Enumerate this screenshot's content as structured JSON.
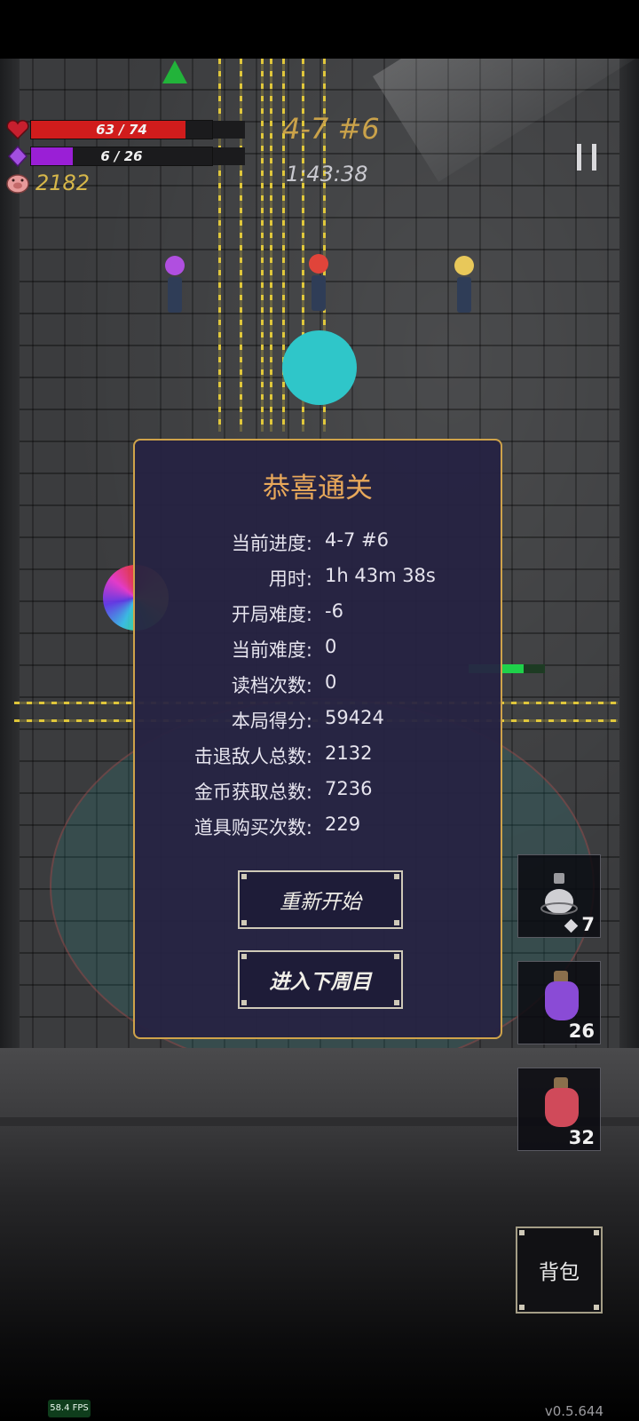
{
  "hud": {
    "hp": {
      "current": 63,
      "max": 74,
      "text": "63 / 74",
      "color": "#d01c1c"
    },
    "mana": {
      "current": 6,
      "max": 26,
      "text": "6 / 26",
      "color": "#9a1fd6"
    },
    "gold": "2182",
    "level": "4-7 #6",
    "timer": "1:43:38",
    "icons": {
      "hp": "heart-icon",
      "mana": "diamond-icon",
      "gold": "pig-icon",
      "pause": "pause-icon"
    }
  },
  "dialog": {
    "title": "恭喜通关",
    "stats": [
      {
        "label": "当前进度:",
        "value": "4-7 #6"
      },
      {
        "label": "用时:",
        "value": "1h 43m 38s"
      },
      {
        "label": "开局难度:",
        "value": "-6"
      },
      {
        "label": "当前难度:",
        "value": "0"
      },
      {
        "label": "读档次数:",
        "value": "0"
      },
      {
        "label": "本局得分:",
        "value": "59424"
      },
      {
        "label": "击退敌人总数:",
        "value": "2132"
      },
      {
        "label": "金币获取总数:",
        "value": "7236"
      },
      {
        "label": "道具购买次数:",
        "value": "229"
      }
    ],
    "buttons": {
      "restart": "重新开始",
      "next_cycle": "进入下周目"
    }
  },
  "items": [
    {
      "icon": "smoke-flask-icon",
      "count": "7",
      "has_diamond": true
    },
    {
      "icon": "purple-potion-icon",
      "count": "26",
      "color": "#8a4bd6"
    },
    {
      "icon": "red-potion-icon",
      "count": "32",
      "color": "#d04a5a"
    }
  ],
  "backpack_label": "背包",
  "fps": "58.4 FPS",
  "version": "v0.5.644",
  "enemy_hp_fraction": 0.72
}
